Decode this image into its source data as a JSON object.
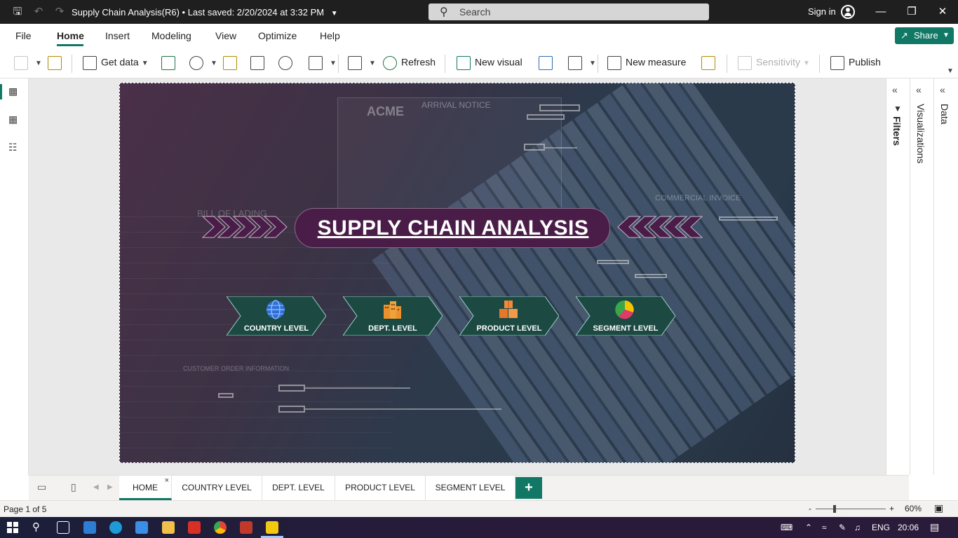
{
  "app": {
    "document_title": "Supply Chain Analysis(R6)",
    "save_status": "Last saved: 2/20/2024 at 3:32 PM",
    "search_placeholder": "Search",
    "sign_in": "Sign in"
  },
  "menu": {
    "items": [
      "File",
      "Home",
      "Insert",
      "Modeling",
      "View",
      "Optimize",
      "Help"
    ],
    "active": "Home",
    "share_label": "Share"
  },
  "ribbon": {
    "get_data": "Get data",
    "refresh": "Refresh",
    "new_visual": "New visual",
    "new_measure": "New measure",
    "sensitivity": "Sensitivity",
    "publish": "Publish"
  },
  "panes": {
    "filters": "Filters",
    "visualizations": "Visualizations",
    "data": "Data"
  },
  "report": {
    "title": "SUPPLY CHAIN ANALYSIS",
    "bg_text": {
      "acme": "ACME",
      "arrival_notice": "ARRIVAL NOTICE",
      "bill_of_lading": "BILL OF LADING",
      "commercial_invoice": "COMMERCIAL INVOICE",
      "customer_order": "CUSTOMER ORDER INFORMATION"
    },
    "nav_buttons": [
      {
        "label": "COUNTRY LEVEL",
        "icon": "globe-icon"
      },
      {
        "label": "DEPT. LEVEL",
        "icon": "building-icon"
      },
      {
        "label": "PRODUCT LEVEL",
        "icon": "boxes-icon"
      },
      {
        "label": "SEGMENT LEVEL",
        "icon": "pie-chart-icon"
      }
    ],
    "colors": {
      "title_pill": "#4a1d48",
      "nav_tile": "#1c4a43",
      "accent": "#117865"
    }
  },
  "page_tabs": {
    "tabs": [
      "HOME",
      "COUNTRY LEVEL",
      "DEPT. LEVEL",
      "PRODUCT LEVEL",
      "SEGMENT LEVEL"
    ],
    "active": "HOME"
  },
  "status": {
    "page_info": "Page 1 of 5",
    "zoom_minus": "-",
    "zoom_plus": "+",
    "zoom_level": "60%"
  },
  "taskbar": {
    "language": "ENG",
    "time": "20:06"
  }
}
